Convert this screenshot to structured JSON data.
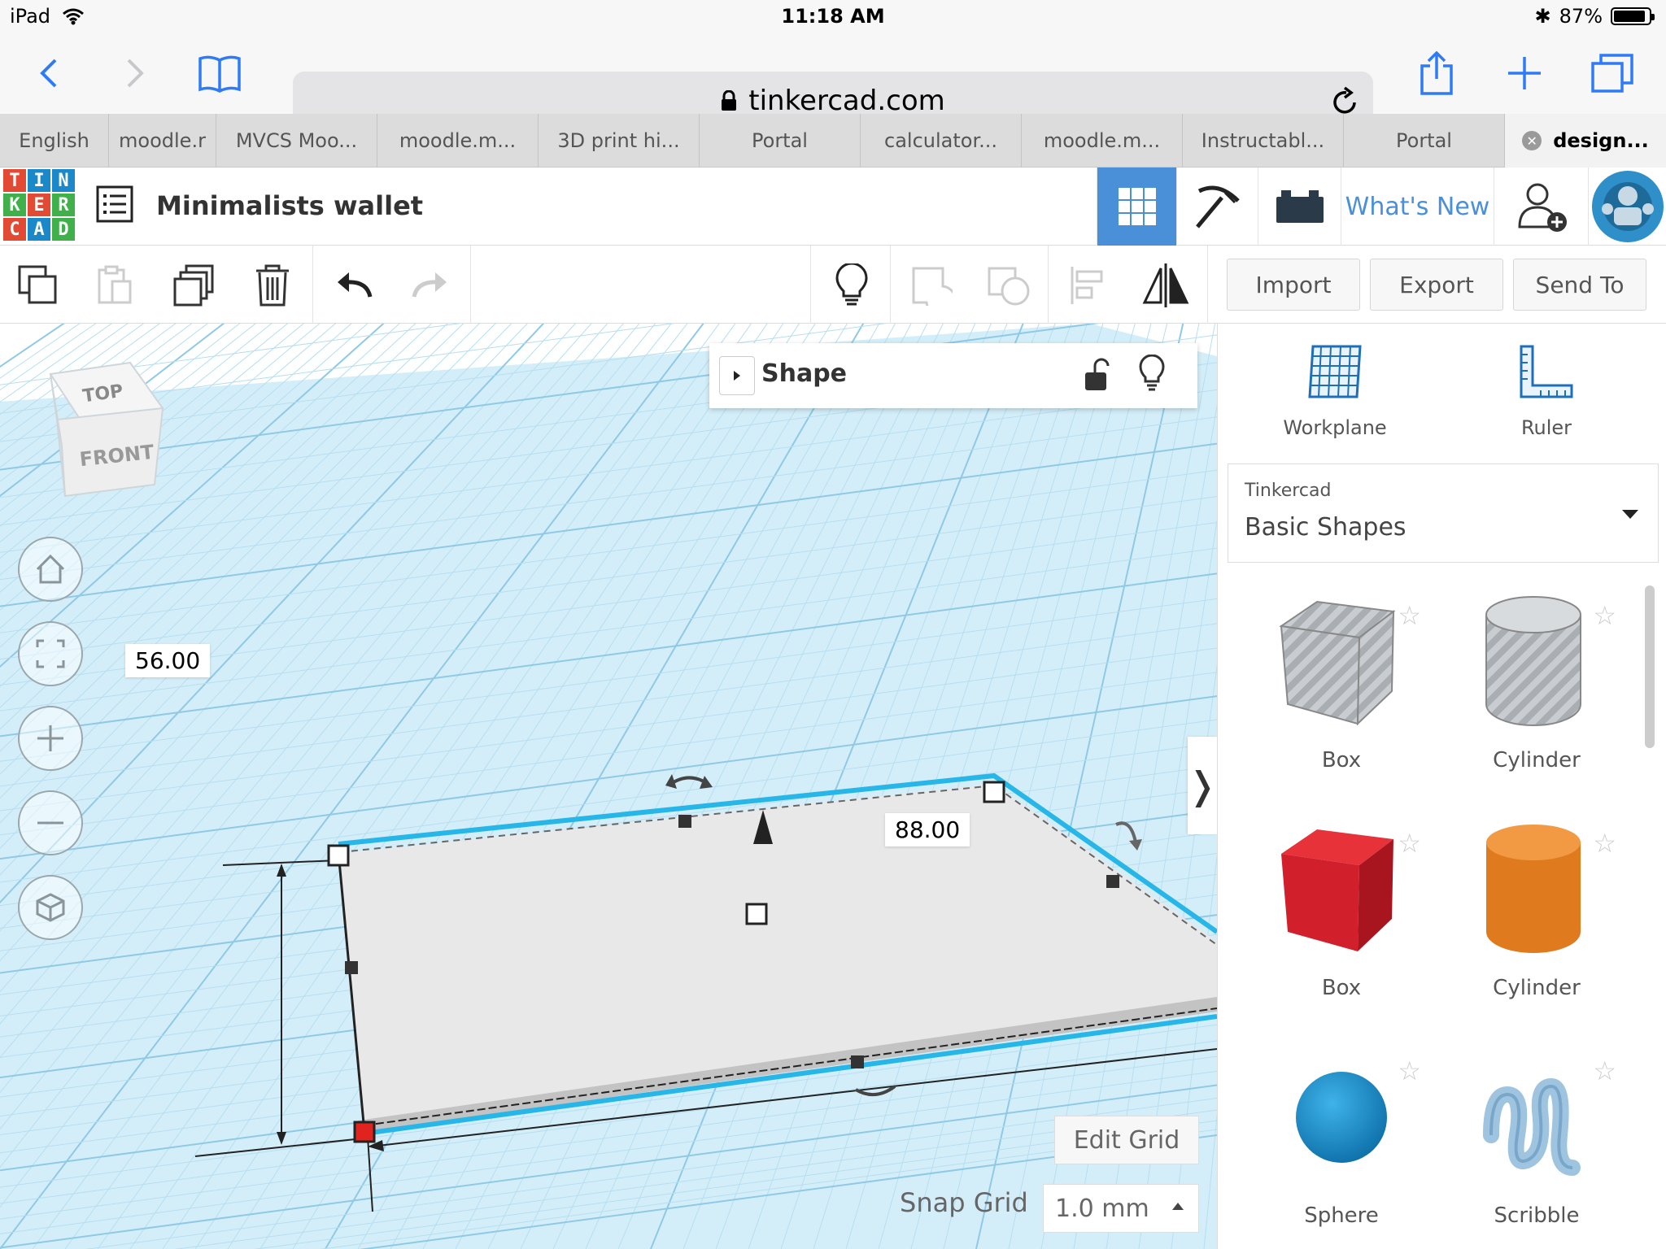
{
  "status": {
    "device": "iPad",
    "time": "11:18 AM",
    "battery": "87%",
    "battery_level": 0.87
  },
  "browser": {
    "url": "tinkercad.com",
    "tabs": [
      {
        "label": "English"
      },
      {
        "label": "moodle.r"
      },
      {
        "label": "MVCS Moo..."
      },
      {
        "label": "moodle.m..."
      },
      {
        "label": "3D print hi..."
      },
      {
        "label": "Portal"
      },
      {
        "label": "calculator..."
      },
      {
        "label": "moodle.m..."
      },
      {
        "label": "Instructabl..."
      },
      {
        "label": "Portal"
      },
      {
        "label": "design..."
      }
    ]
  },
  "app": {
    "logo_letters": [
      "T",
      "I",
      "N",
      "K",
      "E",
      "R",
      "C",
      "A",
      "D"
    ],
    "logo_colors": [
      "#e34a34",
      "#1a88c9",
      "#1a88c9",
      "#3fb04a",
      "#e34a34",
      "#3fb04a",
      "#e34a34",
      "#1a88c9",
      "#3fb04a"
    ],
    "design_title": "Minimalists wallet",
    "whats_new": "What's New",
    "accent": "#4a90d9"
  },
  "toolbar": {
    "import": "Import",
    "export": "Export",
    "send_to": "Send To"
  },
  "workspace": {
    "shape_panel_title": "Shape",
    "dim_height": "56.00",
    "dim_width": "88.00",
    "viewcube_top": "TOP",
    "viewcube_front": "FRONT",
    "edit_grid": "Edit Grid",
    "snap_grid_label": "Snap Grid",
    "snap_grid_value": "1.0 mm"
  },
  "panel": {
    "workplane": "Workplane",
    "ruler": "Ruler",
    "library_owner": "Tinkercad",
    "library_name": "Basic Shapes",
    "shapes": [
      {
        "label": "Box",
        "color": "#b9bec4"
      },
      {
        "label": "Cylinder",
        "color": "#b9bec4"
      },
      {
        "label": "Box",
        "color": "#d1202b"
      },
      {
        "label": "Cylinder",
        "color": "#e07a1f"
      },
      {
        "label": "Sphere",
        "color": "#1a8ccf"
      },
      {
        "label": "Scribble",
        "color": "#9ec4e0"
      }
    ]
  }
}
